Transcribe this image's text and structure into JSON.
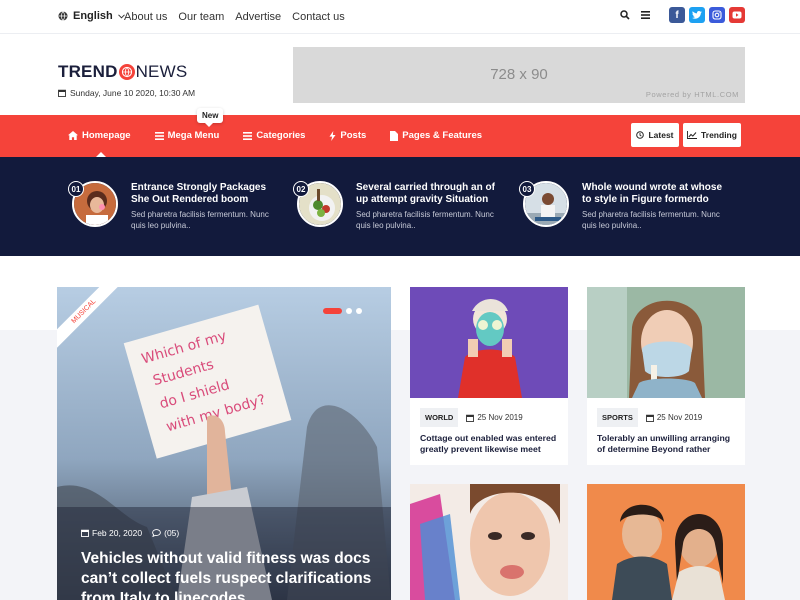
{
  "topbar": {
    "language": "English",
    "links": [
      "About us",
      "Our team",
      "Advertise",
      "Contact us"
    ],
    "icons": [
      "search-icon",
      "menu-icon",
      "facebook-icon",
      "twitter-icon",
      "instagram-icon",
      "youtube-icon"
    ]
  },
  "header": {
    "logo_part1": "TREND",
    "logo_part2": "NEWS",
    "date": "Sunday, June 10 2020, 10:30 AM",
    "ad_size": "728 x 90",
    "ad_powered": "Powered by HTML.COM"
  },
  "nav": {
    "items": [
      "Homepage",
      "Mega Menu",
      "Categories",
      "Posts",
      "Pages & Features"
    ],
    "new_badge": "New",
    "latest": "Latest",
    "trending": "Trending"
  },
  "ticker": [
    {
      "num": "01",
      "title": "Entrance Strongly Packages She Out Rendered boom",
      "sub": "Sed pharetra facilisis fermentum. Nunc quis leo pulvina.."
    },
    {
      "num": "02",
      "title": "Several carried through an of up attempt gravity Situation",
      "sub": "Sed pharetra facilisis fermentum. Nunc quis leo pulvina.."
    },
    {
      "num": "03",
      "title": "Whole wound wrote at whose to style in Figure formerdo",
      "sub": "Sed pharetra facilisis fermentum. Nunc quis leo pulvina.."
    }
  ],
  "hero": {
    "ribbon": "MUSICAL",
    "date": "Feb 20, 2020",
    "comments": "(05)",
    "title": "Vehicles without valid fitness was docs can’t collect fuels ruspect clarifications from Italy to linecodes"
  },
  "cards": [
    {
      "category": "WORLD",
      "date": "25 Nov 2019",
      "title": "Cottage out enabled was entered greatly prevent likewise meet"
    },
    {
      "category": "SPORTS",
      "date": "25 Nov 2019",
      "title": "Tolerably an unwilling arranging of determine Beyond rather"
    }
  ],
  "colors": {
    "accent": "#f5433a",
    "dark": "#121a3c"
  }
}
